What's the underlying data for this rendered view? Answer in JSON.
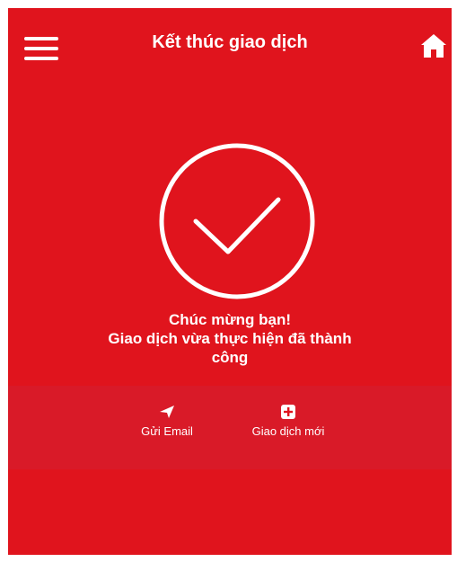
{
  "header": {
    "title": "Kết thúc giao dịch",
    "menu_icon": "hamburger-menu-icon",
    "home_icon": "home-icon"
  },
  "result": {
    "icon": "check-circle-icon",
    "line1": "Chúc mừng bạn!",
    "line2": "Giao dịch vừa thực hiện đã thành công"
  },
  "actions": {
    "email": {
      "label": "Gửi Email",
      "icon": "send-icon"
    },
    "new_transaction": {
      "label": "Giao dịch mới",
      "icon": "plus-square-icon"
    }
  },
  "colors": {
    "background": "#e0141d",
    "band": "#d91a28",
    "foreground": "#ffffff"
  }
}
